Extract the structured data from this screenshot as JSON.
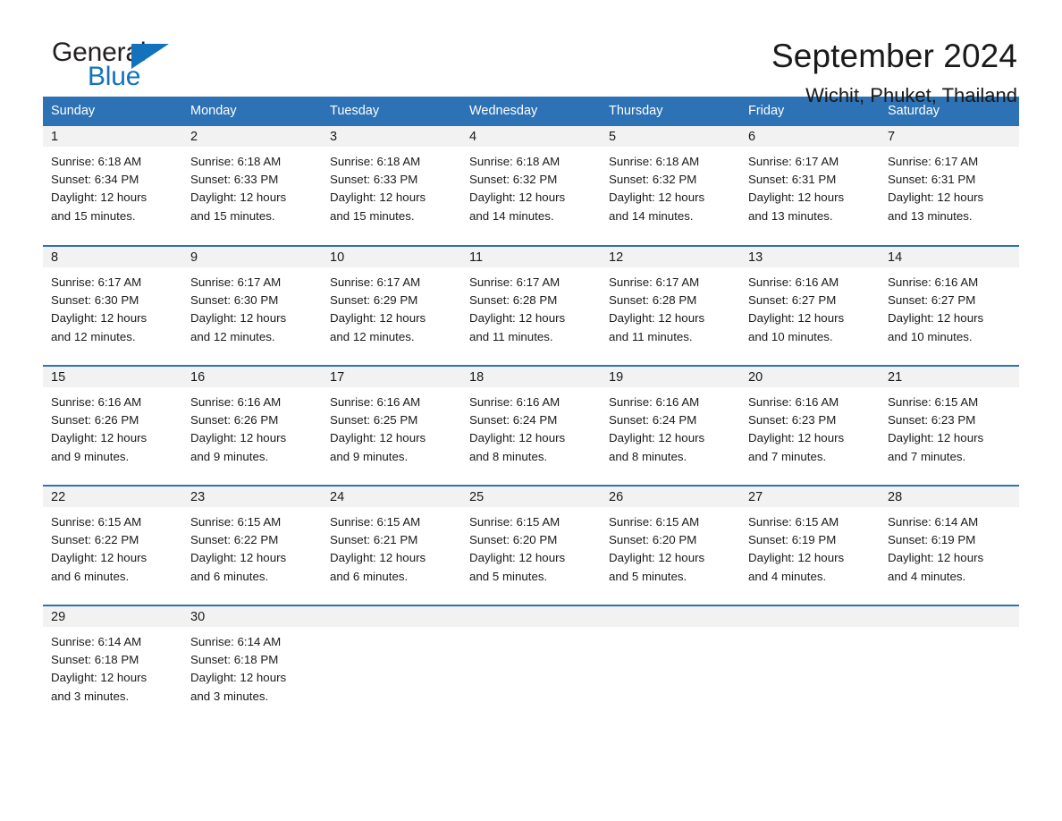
{
  "brand": {
    "name_part1": "General",
    "name_part2": "Blue"
  },
  "header": {
    "title": "September 2024",
    "subtitle": "Wichit, Phuket, Thailand"
  },
  "colors": {
    "header_blue": "#2c72b4",
    "brand_blue": "#1272bc",
    "daynum_band": "#f2f2f2",
    "text": "#1a1a1a"
  },
  "weekdays": [
    "Sunday",
    "Monday",
    "Tuesday",
    "Wednesday",
    "Thursday",
    "Friday",
    "Saturday"
  ],
  "weeks": [
    [
      {
        "day": "1",
        "sunrise": "Sunrise: 6:18 AM",
        "sunset": "Sunset: 6:34 PM",
        "daylight1": "Daylight: 12 hours",
        "daylight2": "and 15 minutes."
      },
      {
        "day": "2",
        "sunrise": "Sunrise: 6:18 AM",
        "sunset": "Sunset: 6:33 PM",
        "daylight1": "Daylight: 12 hours",
        "daylight2": "and 15 minutes."
      },
      {
        "day": "3",
        "sunrise": "Sunrise: 6:18 AM",
        "sunset": "Sunset: 6:33 PM",
        "daylight1": "Daylight: 12 hours",
        "daylight2": "and 15 minutes."
      },
      {
        "day": "4",
        "sunrise": "Sunrise: 6:18 AM",
        "sunset": "Sunset: 6:32 PM",
        "daylight1": "Daylight: 12 hours",
        "daylight2": "and 14 minutes."
      },
      {
        "day": "5",
        "sunrise": "Sunrise: 6:18 AM",
        "sunset": "Sunset: 6:32 PM",
        "daylight1": "Daylight: 12 hours",
        "daylight2": "and 14 minutes."
      },
      {
        "day": "6",
        "sunrise": "Sunrise: 6:17 AM",
        "sunset": "Sunset: 6:31 PM",
        "daylight1": "Daylight: 12 hours",
        "daylight2": "and 13 minutes."
      },
      {
        "day": "7",
        "sunrise": "Sunrise: 6:17 AM",
        "sunset": "Sunset: 6:31 PM",
        "daylight1": "Daylight: 12 hours",
        "daylight2": "and 13 minutes."
      }
    ],
    [
      {
        "day": "8",
        "sunrise": "Sunrise: 6:17 AM",
        "sunset": "Sunset: 6:30 PM",
        "daylight1": "Daylight: 12 hours",
        "daylight2": "and 12 minutes."
      },
      {
        "day": "9",
        "sunrise": "Sunrise: 6:17 AM",
        "sunset": "Sunset: 6:30 PM",
        "daylight1": "Daylight: 12 hours",
        "daylight2": "and 12 minutes."
      },
      {
        "day": "10",
        "sunrise": "Sunrise: 6:17 AM",
        "sunset": "Sunset: 6:29 PM",
        "daylight1": "Daylight: 12 hours",
        "daylight2": "and 12 minutes."
      },
      {
        "day": "11",
        "sunrise": "Sunrise: 6:17 AM",
        "sunset": "Sunset: 6:28 PM",
        "daylight1": "Daylight: 12 hours",
        "daylight2": "and 11 minutes."
      },
      {
        "day": "12",
        "sunrise": "Sunrise: 6:17 AM",
        "sunset": "Sunset: 6:28 PM",
        "daylight1": "Daylight: 12 hours",
        "daylight2": "and 11 minutes."
      },
      {
        "day": "13",
        "sunrise": "Sunrise: 6:16 AM",
        "sunset": "Sunset: 6:27 PM",
        "daylight1": "Daylight: 12 hours",
        "daylight2": "and 10 minutes."
      },
      {
        "day": "14",
        "sunrise": "Sunrise: 6:16 AM",
        "sunset": "Sunset: 6:27 PM",
        "daylight1": "Daylight: 12 hours",
        "daylight2": "and 10 minutes."
      }
    ],
    [
      {
        "day": "15",
        "sunrise": "Sunrise: 6:16 AM",
        "sunset": "Sunset: 6:26 PM",
        "daylight1": "Daylight: 12 hours",
        "daylight2": "and 9 minutes."
      },
      {
        "day": "16",
        "sunrise": "Sunrise: 6:16 AM",
        "sunset": "Sunset: 6:26 PM",
        "daylight1": "Daylight: 12 hours",
        "daylight2": "and 9 minutes."
      },
      {
        "day": "17",
        "sunrise": "Sunrise: 6:16 AM",
        "sunset": "Sunset: 6:25 PM",
        "daylight1": "Daylight: 12 hours",
        "daylight2": "and 9 minutes."
      },
      {
        "day": "18",
        "sunrise": "Sunrise: 6:16 AM",
        "sunset": "Sunset: 6:24 PM",
        "daylight1": "Daylight: 12 hours",
        "daylight2": "and 8 minutes."
      },
      {
        "day": "19",
        "sunrise": "Sunrise: 6:16 AM",
        "sunset": "Sunset: 6:24 PM",
        "daylight1": "Daylight: 12 hours",
        "daylight2": "and 8 minutes."
      },
      {
        "day": "20",
        "sunrise": "Sunrise: 6:16 AM",
        "sunset": "Sunset: 6:23 PM",
        "daylight1": "Daylight: 12 hours",
        "daylight2": "and 7 minutes."
      },
      {
        "day": "21",
        "sunrise": "Sunrise: 6:15 AM",
        "sunset": "Sunset: 6:23 PM",
        "daylight1": "Daylight: 12 hours",
        "daylight2": "and 7 minutes."
      }
    ],
    [
      {
        "day": "22",
        "sunrise": "Sunrise: 6:15 AM",
        "sunset": "Sunset: 6:22 PM",
        "daylight1": "Daylight: 12 hours",
        "daylight2": "and 6 minutes."
      },
      {
        "day": "23",
        "sunrise": "Sunrise: 6:15 AM",
        "sunset": "Sunset: 6:22 PM",
        "daylight1": "Daylight: 12 hours",
        "daylight2": "and 6 minutes."
      },
      {
        "day": "24",
        "sunrise": "Sunrise: 6:15 AM",
        "sunset": "Sunset: 6:21 PM",
        "daylight1": "Daylight: 12 hours",
        "daylight2": "and 6 minutes."
      },
      {
        "day": "25",
        "sunrise": "Sunrise: 6:15 AM",
        "sunset": "Sunset: 6:20 PM",
        "daylight1": "Daylight: 12 hours",
        "daylight2": "and 5 minutes."
      },
      {
        "day": "26",
        "sunrise": "Sunrise: 6:15 AM",
        "sunset": "Sunset: 6:20 PM",
        "daylight1": "Daylight: 12 hours",
        "daylight2": "and 5 minutes."
      },
      {
        "day": "27",
        "sunrise": "Sunrise: 6:15 AM",
        "sunset": "Sunset: 6:19 PM",
        "daylight1": "Daylight: 12 hours",
        "daylight2": "and 4 minutes."
      },
      {
        "day": "28",
        "sunrise": "Sunrise: 6:14 AM",
        "sunset": "Sunset: 6:19 PM",
        "daylight1": "Daylight: 12 hours",
        "daylight2": "and 4 minutes."
      }
    ],
    [
      {
        "day": "29",
        "sunrise": "Sunrise: 6:14 AM",
        "sunset": "Sunset: 6:18 PM",
        "daylight1": "Daylight: 12 hours",
        "daylight2": "and 3 minutes."
      },
      {
        "day": "30",
        "sunrise": "Sunrise: 6:14 AM",
        "sunset": "Sunset: 6:18 PM",
        "daylight1": "Daylight: 12 hours",
        "daylight2": "and 3 minutes."
      },
      {
        "day": "",
        "sunrise": "",
        "sunset": "",
        "daylight1": "",
        "daylight2": ""
      },
      {
        "day": "",
        "sunrise": "",
        "sunset": "",
        "daylight1": "",
        "daylight2": ""
      },
      {
        "day": "",
        "sunrise": "",
        "sunset": "",
        "daylight1": "",
        "daylight2": ""
      },
      {
        "day": "",
        "sunrise": "",
        "sunset": "",
        "daylight1": "",
        "daylight2": ""
      },
      {
        "day": "",
        "sunrise": "",
        "sunset": "",
        "daylight1": "",
        "daylight2": ""
      }
    ]
  ]
}
